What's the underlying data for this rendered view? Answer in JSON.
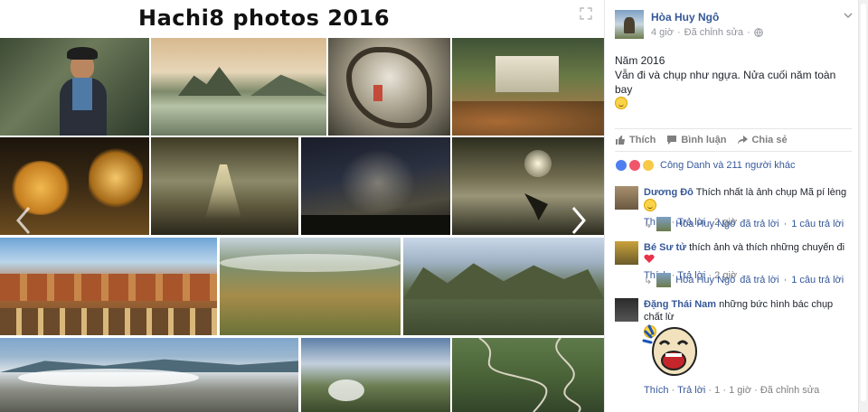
{
  "album": {
    "title": "Hachi8 photos 2016"
  },
  "post": {
    "author": "Hòa Huy Ngô",
    "time": "4 giờ",
    "edited": "Đã chỉnh sửa",
    "line1": "Năm 2016",
    "line2": "Vẫn đi và chụp như ngựa. Nửa cuối năm toàn bay"
  },
  "actions": {
    "like": "Thích",
    "comment": "Bình luận",
    "share": "Chia sẻ"
  },
  "reactions": {
    "summary": "Công Danh và 211 người khác"
  },
  "comments": [
    {
      "name": "Dương Đô",
      "text": "Thích nhất là ảnh chụp Mã pí lèng",
      "like": "Thích",
      "reply": "Trả lời",
      "time": "2 giờ",
      "reply_author": "Hòa Huy Ngô",
      "reply_action": "đã trả lời",
      "reply_count": "1 câu trả lời"
    },
    {
      "name": "Bé Sư tử",
      "text": "thích ảnh và thích những chuyến đi",
      "like": "Thích",
      "reply": "Trả lời",
      "time": "2 giờ",
      "reply_author": "Hòa Huy Ngô",
      "reply_action": "đã trả lời",
      "reply_count": "1 câu trả lời"
    },
    {
      "name": "Đặng Thái Nam",
      "text": "những bức hình bác chụp chất lừ",
      "like": "Thích",
      "reply": "Trả lời",
      "likes": "1",
      "time": "1 giờ",
      "edited": "Đã chỉnh sửa"
    }
  ],
  "separators": {
    "dot": "·"
  },
  "colors": {
    "link": "#365899",
    "meta": "#90949c",
    "text": "#1d2129",
    "divider": "#e5e6e9"
  },
  "icons": {
    "expand": "expand-icon",
    "chevron": "chevron-down-icon",
    "globe": "globe-icon",
    "like": "thumbs-up-icon",
    "comment": "speech-bubble-icon",
    "share": "share-arrow-icon",
    "prev": "chevron-left-icon",
    "next": "chevron-right-icon"
  }
}
